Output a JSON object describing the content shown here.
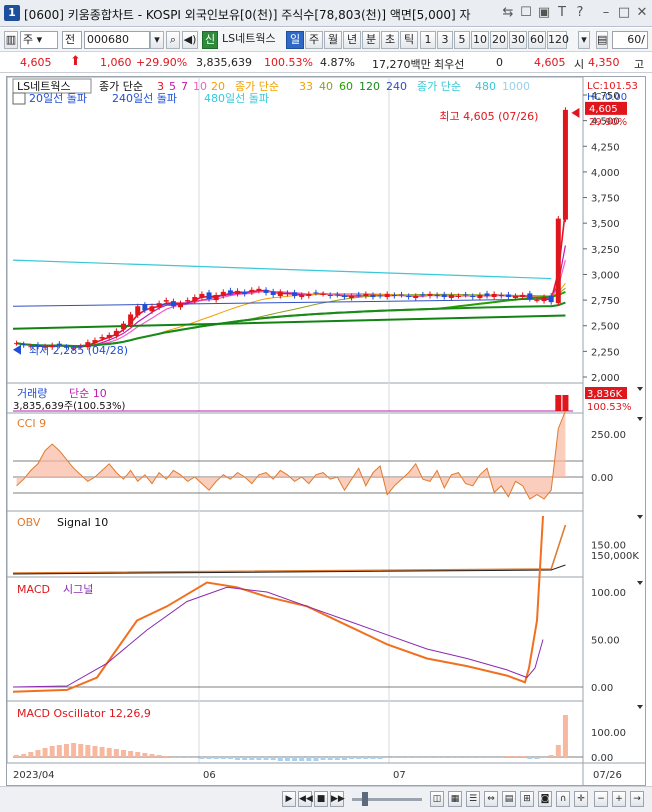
{
  "window": {
    "number": "1",
    "title": "[0600] 키움종합차트 - KOSPI 외국인보유[0(천)] 주식수[78,803(천)] 액면[5,000] 자"
  },
  "toolbar": {
    "type_select": "주",
    "scope": "전",
    "code": "000680",
    "indicator_badge": "신",
    "stock_name": "LS네트웍스",
    "periods": [
      "일",
      "주",
      "월",
      "년",
      "분",
      "초",
      "틱"
    ],
    "active_period": "일",
    "intervals": [
      "1",
      "3",
      "5",
      "10",
      "20",
      "30",
      "60",
      "120"
    ],
    "count": "60/"
  },
  "quote": {
    "price": "4,605",
    "change": "1,060",
    "change_pct": "+29.90%",
    "volume": "3,835,639",
    "volume_ratio": "100.53%",
    "turnover": "4.87%",
    "amount": "17,270백만",
    "label_pref": "최우선",
    "pref_value": "0",
    "ask": "4,605",
    "open_label": "시",
    "open": "4,350",
    "high_label": "고"
  },
  "price_panel": {
    "legend_stock": "LS네트웍스",
    "legend_ma_label": "종가 단순",
    "legend_ma_short": [
      "3",
      "5",
      "7",
      "10",
      "20"
    ],
    "legend_ma_mid_label": "종가 단순",
    "legend_ma_mid": [
      "33",
      "40",
      "60",
      "120",
      "240"
    ],
    "legend_ma_long_label": "종가 단순",
    "legend_ma_long": [
      "480",
      "1000"
    ],
    "legend_line2": [
      "20일선 돌파",
      "240일선 돌파",
      "480일선 돌파"
    ],
    "lc": "LC:101.53",
    "hc": "HC:0.00",
    "current_tag": "4,605",
    "current_pct": "29.90%",
    "high_annotation": "최고 4,605 (07/26)",
    "low_annotation": "최저 2,285 (04/28)",
    "y_ticks": [
      "4,750",
      "4,500",
      "4,250",
      "4,000",
      "3,750",
      "3,500",
      "3,250",
      "3,000",
      "2,750",
      "2,500",
      "2,250",
      "2,000"
    ]
  },
  "volume_panel": {
    "label": "거래량",
    "ma_label": "단순 10",
    "value": "3,835,639주(100.53%)",
    "tag_value": "3,836K",
    "tag_pct": "100.53%"
  },
  "cci_panel": {
    "label": "CCI 9",
    "y_ticks": [
      "250.00",
      "0.00"
    ]
  },
  "obv_panel": {
    "label": "OBV",
    "signal": "Signal 10",
    "y_ticks": [
      "150,000K"
    ]
  },
  "macd_panel": {
    "label": "MACD",
    "signal": "시그널",
    "y_ticks": [
      "150.00",
      "100.00",
      "50.00",
      "0.00"
    ]
  },
  "osc_panel": {
    "label": "MACD Oscillator 12,26,9",
    "y_ticks": [
      "100.00",
      "0.00"
    ]
  },
  "x_axis": {
    "labels": [
      "2023/04",
      "06",
      "07"
    ],
    "end_label": "07/26"
  },
  "colors": {
    "up": "#e0161d",
    "down": "#1f4fd8",
    "cci": "#e07b2e",
    "macd": "#f07020",
    "signal": "#8a2bb0"
  },
  "chart_data": {
    "type": "candlestick",
    "series": [
      {
        "name": "LS네트웍스",
        "values": [
          2330,
          2310,
          2300,
          2295,
          2300,
          2310,
          2305,
          2290,
          2285,
          2300,
          2340,
          2360,
          2390,
          2410,
          2450,
          2520,
          2610,
          2690,
          2650,
          2690,
          2720,
          2750,
          2690,
          2720,
          2750,
          2780,
          2810,
          2760,
          2800,
          2830,
          2820,
          2840,
          2810,
          2850,
          2860,
          2820,
          2800,
          2830,
          2810,
          2790,
          2800,
          2810,
          2820,
          2810,
          2790,
          2800,
          2780,
          2790,
          2800,
          2810,
          2780,
          2790,
          2810,
          2790,
          2800,
          2780,
          2790,
          2800,
          2810,
          2790,
          2780,
          2800,
          2790,
          2800,
          2780,
          2800,
          2790,
          2810,
          2790,
          2780,
          2790,
          2800,
          2760,
          2750,
          2780,
          2730,
          3545,
          4605
        ]
      }
    ],
    "high": 4605,
    "high_date": "07/26",
    "low": 2285,
    "low_date": "04/28",
    "ylim": [
      2000,
      4750
    ]
  }
}
